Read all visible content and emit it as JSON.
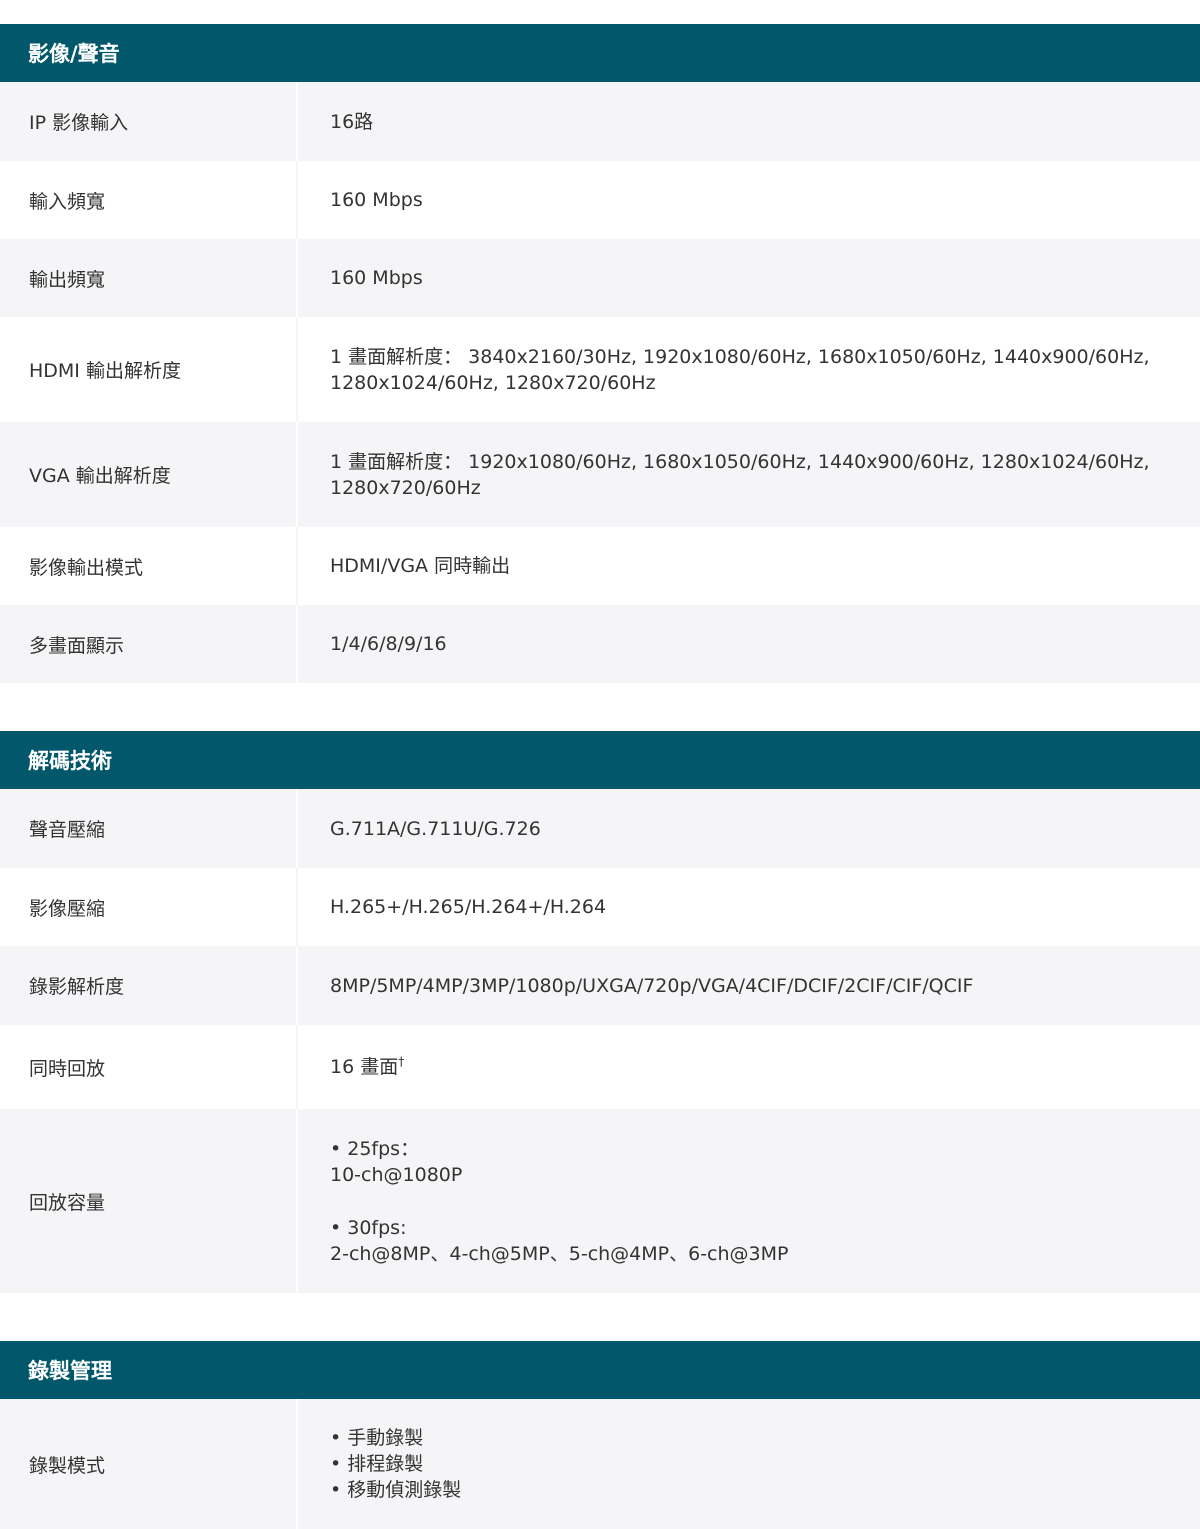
{
  "sections": [
    {
      "title": "影像/聲音",
      "rows": [
        {
          "label": "IP 影像輸入",
          "value": [
            "16路"
          ]
        },
        {
          "label": "輸入頻寬",
          "value": [
            "160 Mbps"
          ]
        },
        {
          "label": "輸出頻寬",
          "value": [
            "160 Mbps"
          ]
        },
        {
          "label": "HDMI 輸出解析度",
          "value": [
            "1 畫面解析度： 3840x2160/30Hz, 1920x1080/60Hz, 1680x1050/60Hz, 1440x900/60Hz,",
            "1280x1024/60Hz, 1280x720/60Hz"
          ]
        },
        {
          "label": "VGA 輸出解析度",
          "value": [
            "1 畫面解析度： 1920x1080/60Hz, 1680x1050/60Hz, 1440x900/60Hz, 1280x1024/60Hz,",
            "1280x720/60Hz"
          ]
        },
        {
          "label": "影像輸出模式",
          "value": [
            "HDMI/VGA 同時輸出"
          ]
        },
        {
          "label": "多畫面顯示",
          "value": [
            "1/4/6/8/9/16"
          ]
        }
      ]
    },
    {
      "title": "解碼技術",
      "rows": [
        {
          "label": "聲音壓縮",
          "value": [
            "G.711A/G.711U/G.726"
          ]
        },
        {
          "label": "影像壓縮",
          "value": [
            "H.265+/H.265/H.264+/H.264"
          ]
        },
        {
          "label": "錄影解析度",
          "value": [
            "8MP/5MP/4MP/3MP/1080p/UXGA/720p/VGA/4CIF/DCIF/2CIF/CIF/QCIF"
          ]
        },
        {
          "label": "同時回放",
          "value": [
            "16 畫面"
          ],
          "sup": "†"
        },
        {
          "label": "回放容量",
          "value": [
            "• 25fps：",
            "10-ch@1080P",
            "",
            "• 30fps:",
            "2-ch@8MP、4-ch@5MP、5-ch@4MP、6-ch@3MP"
          ]
        }
      ]
    },
    {
      "title": "錄製管理",
      "rows": [
        {
          "label": "錄製模式",
          "value": [
            "• 手動錄製",
            "• 排程錄製",
            "• 移動偵測錄製"
          ]
        }
      ]
    }
  ]
}
